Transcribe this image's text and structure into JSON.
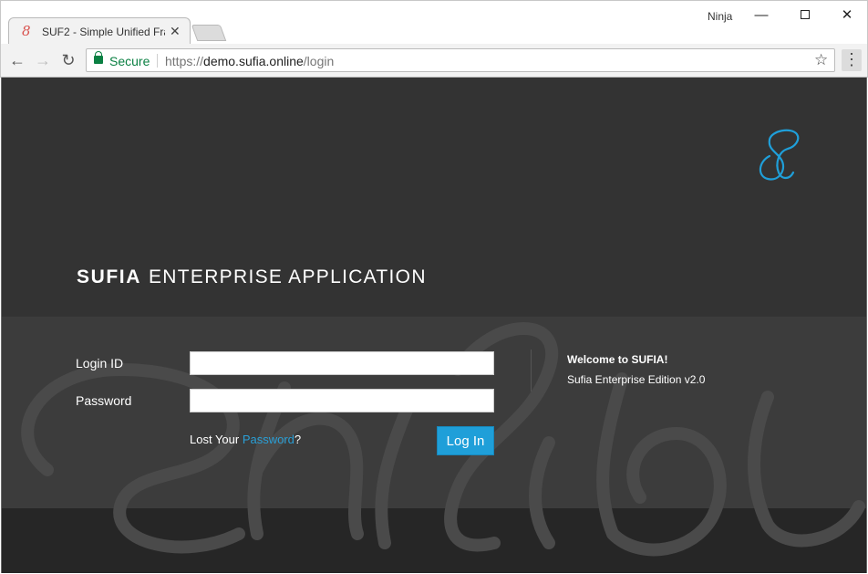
{
  "browser": {
    "tab_title": "SUF2 - Simple Unified Fra",
    "tab_close": "✕",
    "profile_name": "Ninja",
    "secure_label": "Secure",
    "url_scheme": "https://",
    "url_host": "demo.sufia.online",
    "url_path": "/login"
  },
  "header": {
    "brand_strong": "SUFIA",
    "brand_rest": "ENTERPRISE APPLICATION",
    "logo_glyph": "S"
  },
  "form": {
    "login_label": "Login ID",
    "login_value": "",
    "password_label": "Password",
    "password_value": "",
    "lost_prefix": "Lost Your ",
    "lost_link": "Password",
    "lost_suffix": "?",
    "submit_label": "Log In"
  },
  "welcome": {
    "title": "Welcome to SUFIA!",
    "subtitle": "Sufia Enterprise Edition v2.0"
  },
  "colors": {
    "accent": "#1f9fd9",
    "page_bg": "#333333",
    "link": "#2a9fd6",
    "secure": "#0b8043"
  },
  "icons": [
    "favicon-icon",
    "close-icon",
    "back-arrow-icon",
    "forward-arrow-icon",
    "reload-icon",
    "lock-icon",
    "star-icon",
    "more-icon",
    "sufia-logo-icon",
    "watermark-logo"
  ]
}
